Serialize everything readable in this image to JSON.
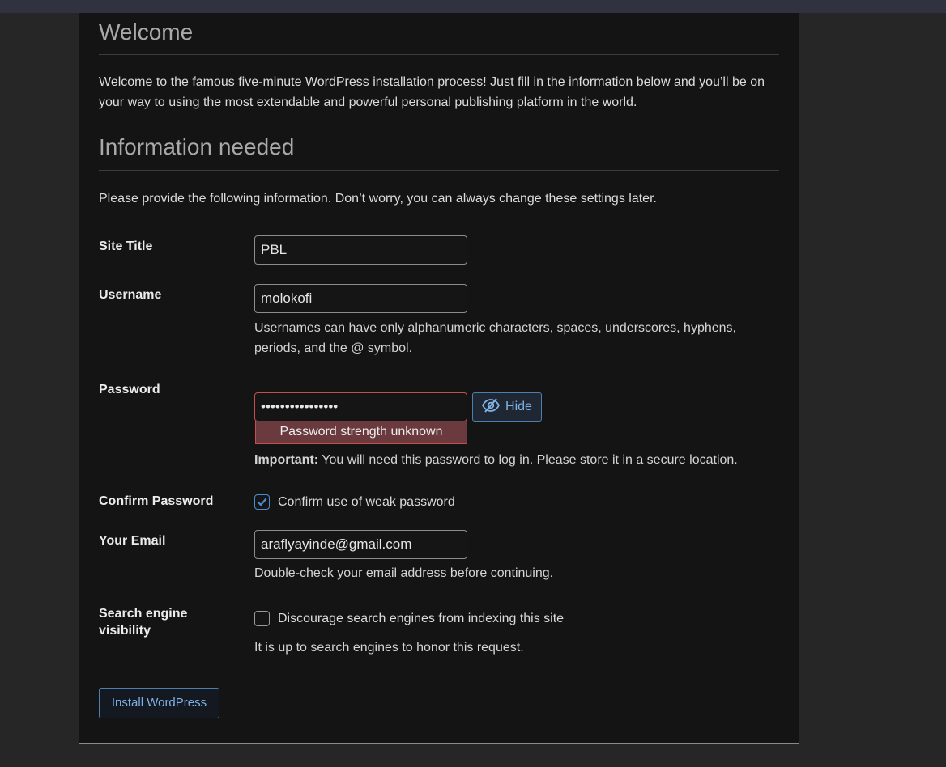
{
  "welcome": {
    "title": "Welcome",
    "text": "Welcome to the famous five-minute WordPress installation process! Just fill in the information below and you’ll be on your way to using the most extendable and powerful personal publishing platform in the world."
  },
  "info": {
    "title": "Information needed",
    "lead": "Please provide the following information. Don’t worry, you can always change these settings later."
  },
  "form": {
    "site_title": {
      "label": "Site Title",
      "value": "PBL"
    },
    "username": {
      "label": "Username",
      "value": "molokofi",
      "hint": "Usernames can have only alphanumeric characters, spaces, underscores, hyphens, periods, and the @ symbol."
    },
    "password": {
      "label": "Password",
      "value": "••••••••••••••••",
      "strength": "Password strength unknown",
      "hide_label": "Hide",
      "important": "Important:",
      "important_text": " You will need this password to log in. Please store it in a secure location."
    },
    "confirm": {
      "label": "Confirm Password",
      "checkbox_label": "Confirm use of weak password",
      "checked": true
    },
    "email": {
      "label": "Your Email",
      "value": "araflyayinde@gmail.com",
      "hint": "Double-check your email address before continuing."
    },
    "search": {
      "label_line1": "Search engine",
      "label_line2": "visibility",
      "checkbox_label": "Discourage search engines from indexing this site",
      "checked": false,
      "hint": "It is up to search engines to honor this request."
    },
    "submit_label": "Install WordPress"
  },
  "colors": {
    "accent": "#7fb2e6",
    "error": "#c84d4d",
    "panel_bg": "#141414"
  },
  "icons": {
    "hide": "eye-slash-icon",
    "check": "checkmark-icon"
  }
}
